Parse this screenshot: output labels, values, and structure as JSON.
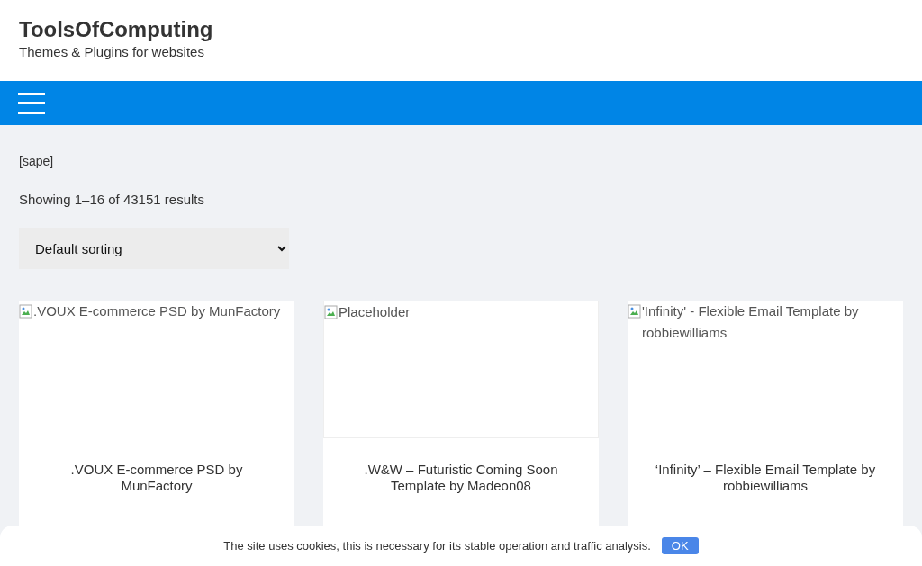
{
  "site": {
    "title": "ToolsOfComputing",
    "tagline": "Themes & Plugins for websites"
  },
  "shortcode": "[sape]",
  "result_count": "Showing 1–16 of 43151 results",
  "sorting": {
    "value": "Default sorting"
  },
  "products": [
    {
      "image_alt": ".VOUX E-commerce PSD by MunFactory",
      "title": ".VOUX E-commerce PSD by MunFactory"
    },
    {
      "image_alt": "Placeholder",
      "title": ".W&W – Futuristic Coming Soon Template by Madeon08"
    },
    {
      "image_alt": "'Infinity' - Flexible Email Template by robbiewilliams",
      "title": "‘Infinity’ – Flexible Email Template by robbiewilliams"
    }
  ],
  "cookie_notice": {
    "text": "The site uses cookies, this is necessary for its stable operation and traffic analysis.",
    "button": "OK"
  }
}
